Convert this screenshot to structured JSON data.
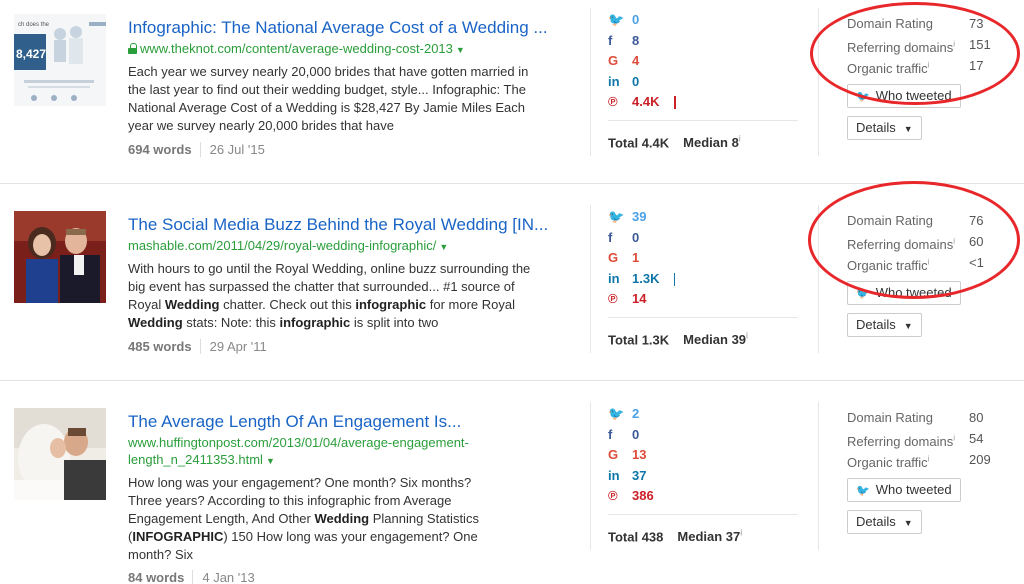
{
  "results": [
    {
      "thumb_text": "8,427",
      "title": "Infographic: The National Average Cost of a Wedding ...",
      "url": "www.theknot.com/content/average-wedding-cost-2013",
      "secure": true,
      "description_parts": [
        {
          "t": "Each year we survey nearly 20,000 brides that have gotten married in the last year to find out their wedding budget, style... Infographic: The National Average Cost of a Wedding is $28,427 By Jamie Miles Each year we survey nearly 20,000 brides that have",
          "b": false
        }
      ],
      "words": "694 words",
      "date": "26 Jul '15",
      "social": {
        "twitter": "0",
        "facebook": "8",
        "googleplus": "4",
        "linkedin": "0",
        "pinterest": "4.4K"
      },
      "total": "Total 4.4K",
      "median": "Median 8",
      "domain_rating": "73",
      "referring_domains": "151",
      "organic_traffic": "17",
      "circled": true
    },
    {
      "title": "The Social Media Buzz Behind the Royal Wedding [IN...",
      "url": "mashable.com/2011/04/29/royal-wedding-infographic/",
      "secure": false,
      "description_parts": [
        {
          "t": "With hours to go until the Royal Wedding, online buzz surrounding the big event has surpassed the chatter that surrounded... #1 source of Royal ",
          "b": false
        },
        {
          "t": "Wedding",
          "b": true
        },
        {
          "t": " chatter. Check out this ",
          "b": false
        },
        {
          "t": "infographic",
          "b": true
        },
        {
          "t": " for more Royal ",
          "b": false
        },
        {
          "t": "Wedding",
          "b": true
        },
        {
          "t": " stats: Note: this ",
          "b": false
        },
        {
          "t": "infographic",
          "b": true
        },
        {
          "t": " is split into two",
          "b": false
        }
      ],
      "words": "485 words",
      "date": "29 Apr '11",
      "social": {
        "twitter": "39",
        "facebook": "0",
        "googleplus": "1",
        "linkedin": "1.3K",
        "pinterest": "14"
      },
      "total": "Total 1.3K",
      "median": "Median 39",
      "domain_rating": "76",
      "referring_domains": "60",
      "organic_traffic": "<1",
      "circled": true
    },
    {
      "title": "The Average Length Of An Engagement Is...",
      "url": "www.huffingtonpost.com/2013/01/04/average-engagement-length_n_2411353.html",
      "secure": false,
      "description_parts": [
        {
          "t": "How long was your engagement? One month? Six months? Three years? According to this infographic from Average Engagement Length, And Other ",
          "b": false
        },
        {
          "t": "Wedding",
          "b": true
        },
        {
          "t": " Planning Statistics (",
          "b": false
        },
        {
          "t": "INFOGRAPHIC",
          "b": true
        },
        {
          "t": ") 150 How long was your engagement? One month? Six",
          "b": false
        }
      ],
      "words": "84 words",
      "date": "4 Jan '13",
      "social": {
        "twitter": "2",
        "facebook": "0",
        "googleplus": "13",
        "linkedin": "37",
        "pinterest": "386"
      },
      "total": "Total 438",
      "median": "Median 37",
      "domain_rating": "80",
      "referring_domains": "54",
      "organic_traffic": "209",
      "circled": false
    }
  ],
  "labels": {
    "domain_rating": "Domain Rating",
    "referring_domains": "Referring domains",
    "organic_traffic": "Organic traffic",
    "info": "i",
    "who_tweeted": "Who tweeted",
    "details": "Details",
    "twitter_icon": "🐦",
    "facebook_icon": "f",
    "googleplus_icon": "G",
    "linkedin_icon": "in",
    "pinterest_icon": "℗"
  },
  "colors": {
    "title": "#1a64c6",
    "url": "#2a9e3a",
    "twitter": "#4ba1e6",
    "facebook": "#3b5998",
    "googleplus": "#dd4b39",
    "linkedin": "#0e76a8",
    "pinterest": "#cb2027",
    "annotation": "#e8272a"
  }
}
